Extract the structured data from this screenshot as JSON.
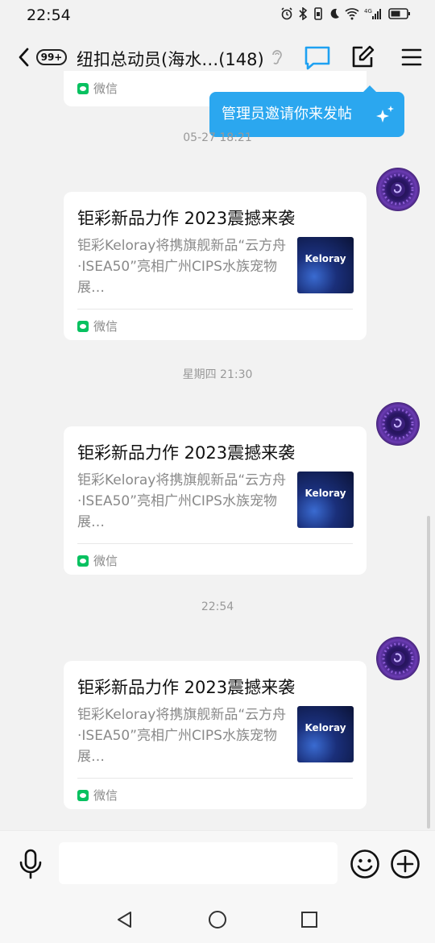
{
  "status_bar": {
    "time": "22:54",
    "network": "4G"
  },
  "header": {
    "badge": "99+",
    "title": "纽扣总动员(海水…(148)"
  },
  "tooltip": {
    "text": "管理员邀请你来发帖"
  },
  "partial_card": {
    "source": "微信"
  },
  "messages": [
    {
      "timestamp": "05-27 18:21",
      "card": {
        "title": "钜彩新品力作 2023震撼来袭",
        "desc": "钜彩Keloray将携旗舰新品“云方舟·ISEA50”亮相广州CIPS水族宠物展…",
        "thumb_text": "Keloray",
        "source": "微信"
      }
    },
    {
      "timestamp": "星期四 21:30",
      "card": {
        "title": "钜彩新品力作 2023震撼来袭",
        "desc": "钜彩Keloray将携旗舰新品“云方舟·ISEA50”亮相广州CIPS水族宠物展…",
        "thumb_text": "Keloray",
        "source": "微信"
      }
    },
    {
      "timestamp": "22:54",
      "card": {
        "title": "钜彩新品力作 2023震撼来袭",
        "desc": "钜彩Keloray将携旗舰新品“云方舟·ISEA50”亮相广州CIPS水族宠物展…",
        "thumb_text": "Keloray",
        "source": "微信"
      }
    }
  ],
  "input_bar": {
    "placeholder": ""
  },
  "colors": {
    "accent": "#1ea1f2",
    "tooltip_bg": "#2ba7ef",
    "wechat_green": "#07c160"
  }
}
